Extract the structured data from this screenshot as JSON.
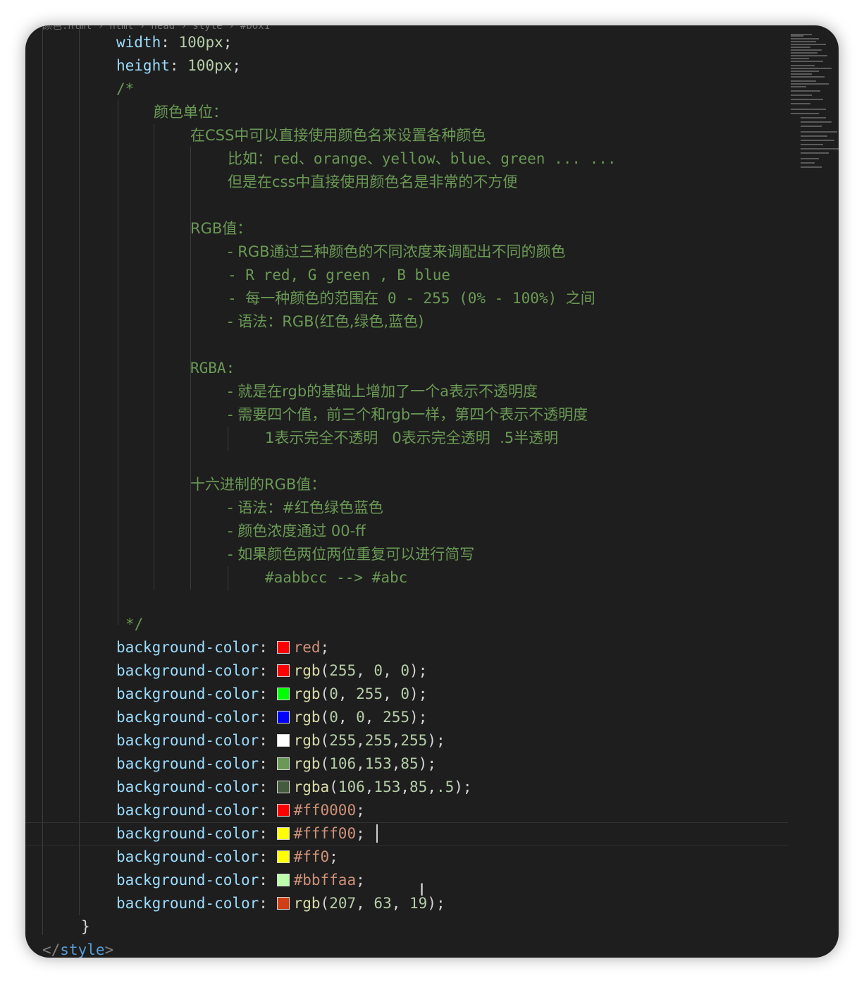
{
  "editor": {
    "breadcrumb": "颜色.html › html › head › style › #box1",
    "lines": {
      "width_prop": "width",
      "width_val": "100px",
      "height_prop": "height",
      "height_val": "100px",
      "comment_open": "/*",
      "c_units": "颜色单位：",
      "c_css_names": "在CSS中可以直接使用颜色名来设置各种颜色",
      "c_example": "比如：red、orange、yellow、blue、green ... ...",
      "c_inconvenient": "但是在css中直接使用颜色名是非常的不方便",
      "c_rgb": "RGB值：",
      "c_rgb_1": "- RGB通过三种颜色的不同浓度来调配出不同的颜色",
      "c_rgb_2": "- R red, G green , B blue",
      "c_rgb_3": "- 每一种颜色的范围在 0 - 255 (0% - 100%) 之间",
      "c_rgb_4": "- 语法：RGB(红色,绿色,蓝色)",
      "c_rgba": "RGBA:",
      "c_rgba_1": "- 就是在rgb的基础上增加了一个a表示不透明度",
      "c_rgba_2": "- 需要四个值，前三个和rgb一样，第四个表示不透明度",
      "c_rgba_3": "1表示完全不透明   0表示完全透明  .5半透明",
      "c_hex": "十六进制的RGB值：",
      "c_hex_1": "- 语法：#红色绿色蓝色",
      "c_hex_2": "- 颜色浓度通过 00-ff",
      "c_hex_3": "- 如果颜色两位两位重复可以进行简写",
      "c_hex_4": "#aabbcc --> #abc",
      "comment_close": "*/",
      "close_brace": "}",
      "style_close": "</style>"
    },
    "bg_prop": "background-color",
    "declarations": [
      {
        "swatch": "#ff0000",
        "kind": "name",
        "value": "red"
      },
      {
        "swatch": "#ff0000",
        "kind": "fn",
        "fn": "rgb",
        "args": "(255, 0, 0)"
      },
      {
        "swatch": "#00ff00",
        "kind": "fn",
        "fn": "rgb",
        "args": "(0, 255, 0)"
      },
      {
        "swatch": "#0000ff",
        "kind": "fn",
        "fn": "rgb",
        "args": "(0, 0, 255)"
      },
      {
        "swatch": "#ffffff",
        "kind": "fn",
        "fn": "rgb",
        "args": "(255,255,255)"
      },
      {
        "swatch": "#6a9955",
        "kind": "fn",
        "fn": "rgb",
        "args": "(106,153,85)"
      },
      {
        "swatch": "#445c3b",
        "kind": "fn",
        "fn": "rgba",
        "args": "(106,153,85,.5)"
      },
      {
        "swatch": "#ff0000",
        "kind": "hex",
        "value": "#ff0000"
      },
      {
        "swatch": "#ffff00",
        "kind": "hex",
        "value": "#ffff00"
      },
      {
        "swatch": "#ffff00",
        "kind": "hex",
        "value": "#ff0"
      },
      {
        "swatch": "#bbffaa",
        "kind": "hex",
        "value": "#bbffaa"
      },
      {
        "swatch": "#cf3f13",
        "kind": "fn",
        "fn": "rgb",
        "args": "(207, 63, 19)"
      }
    ]
  },
  "colors": {
    "background": "#1e1e1e",
    "property": "#9cdcfe",
    "comment": "#6a9955",
    "string_value": "#ce9178",
    "function": "#dcdcaa",
    "number": "#b5cea8",
    "tag": "#569cd6"
  }
}
